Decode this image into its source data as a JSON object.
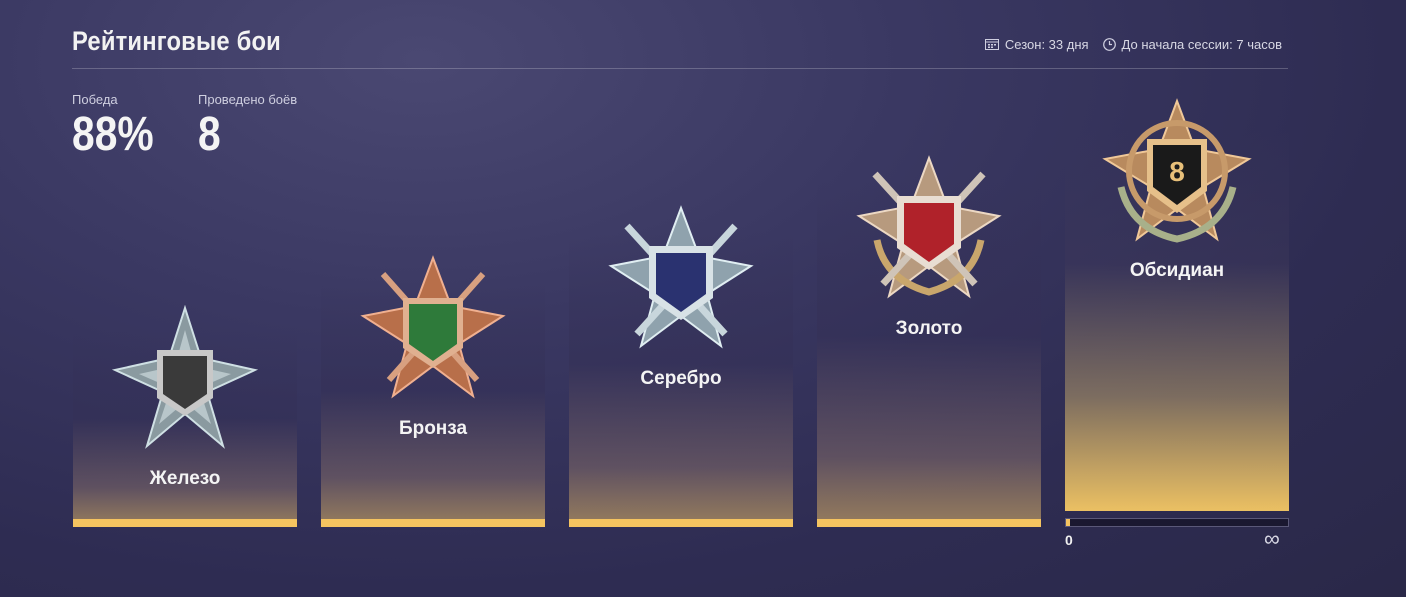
{
  "header": {
    "title": "Рейтинговые бои",
    "season": "Сезон: 33 дня",
    "session": "До начала сессии: 7 часов"
  },
  "stats": {
    "wins_label": "Победа",
    "wins_value": "88%",
    "battles_label": "Проведено боёв",
    "battles_value": "8"
  },
  "leagues": [
    {
      "name": "Железо",
      "icon": "iron-league-badge",
      "color": "#3a3a3a"
    },
    {
      "name": "Бронза",
      "icon": "bronze-league-badge",
      "color": "#2e7a3a"
    },
    {
      "name": "Серебро",
      "icon": "silver-league-badge",
      "color": "#2a3270"
    },
    {
      "name": "Золото",
      "icon": "gold-league-badge",
      "color": "#b0222a"
    },
    {
      "name": "Обсидиан",
      "icon": "obsidian-league-badge",
      "color": "#1a1a1a",
      "badge_number": "8"
    }
  ],
  "progress": {
    "min": "0",
    "max": "∞",
    "value_fraction": 0.02
  },
  "colors": {
    "accent": "#f5c460"
  }
}
